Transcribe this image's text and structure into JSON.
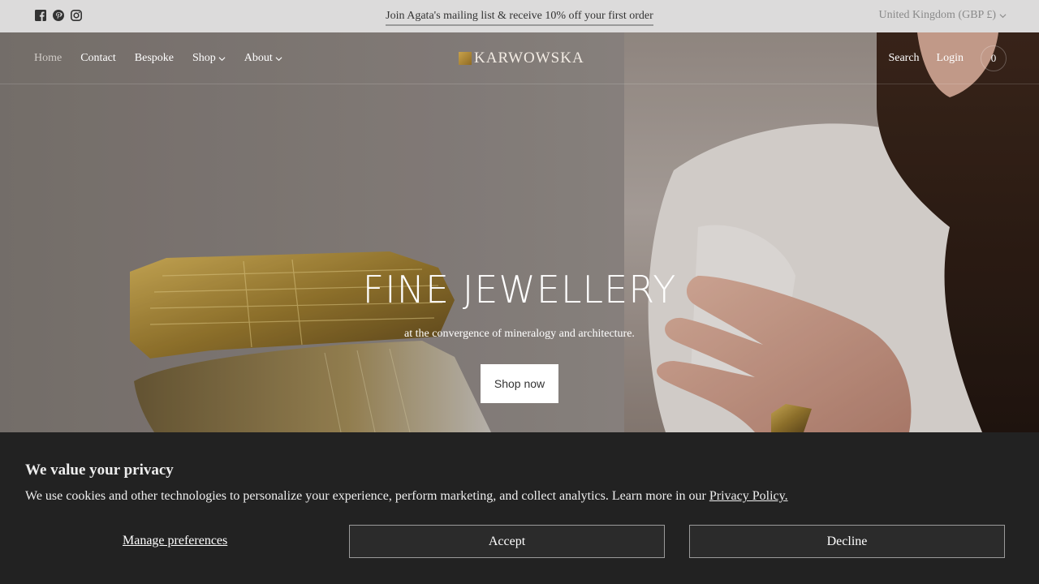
{
  "announcement": {
    "social_icons": [
      "facebook-icon",
      "pinterest-icon",
      "instagram-icon"
    ],
    "text": "Join Agata's mailing list & receive 10% off your first order",
    "currency": "United Kingdom (GBP £)"
  },
  "nav": {
    "left": [
      {
        "label": "Home",
        "active": true
      },
      {
        "label": "Contact"
      },
      {
        "label": "Bespoke"
      },
      {
        "label": "Shop",
        "dropdown": true
      },
      {
        "label": "About",
        "dropdown": true
      }
    ],
    "logo": "KARWOWSKA",
    "search": "Search",
    "login": "Login",
    "cart_count": "0"
  },
  "hero": {
    "title": "FINE JEWELLERY",
    "subtitle": "at the convergence of mineralogy and architecture.",
    "cta": "Shop now"
  },
  "cookie": {
    "title": "We value your privacy",
    "body": "We use cookies and other technologies to personalize your experience, perform marketing, and collect analytics. Learn more in our ",
    "link": "Privacy Policy.",
    "manage": "Manage preferences",
    "accept": "Accept",
    "decline": "Decline"
  },
  "colors": {
    "banner_bg": "#222222",
    "topbar_bg": "#dcdbdb",
    "gold": "#b8963e"
  }
}
